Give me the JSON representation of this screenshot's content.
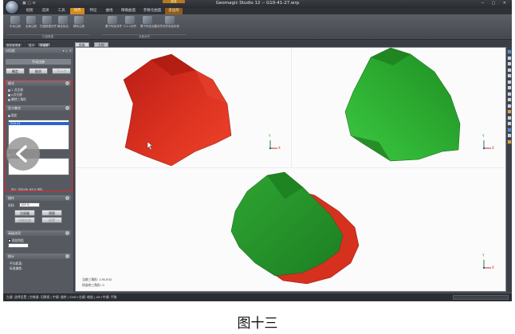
{
  "window": {
    "title": "Geomagic Studio 12 -- G10-41-27.wrp",
    "quick_access": "▣ ▢ ≡",
    "context_label": "配准",
    "controls": "─ ▢ ✕"
  },
  "ribbon": {
    "tabs": [
      {
        "label": "视图",
        "active": false
      },
      {
        "label": "选择",
        "active": false
      },
      {
        "label": "工具",
        "active": false
      },
      {
        "label": "对齐",
        "active": true
      },
      {
        "label": "特征",
        "active": false
      },
      {
        "label": "曲线",
        "active": false
      },
      {
        "label": "精确曲面",
        "active": false
      },
      {
        "label": "参数化曲面",
        "active": false
      },
      {
        "label": "多边形",
        "active": false,
        "context": true
      }
    ],
    "buttons": [
      "手动注册",
      "全局注册",
      "扫描数据对齐",
      "最佳拟合",
      "移除注册",
      "基于特征对齐",
      "3-2-1对齐",
      "基于特征创建对齐",
      "对齐到坐标系"
    ],
    "groups": [
      "扫描数据",
      "对象对齐"
    ]
  },
  "left_panel": {
    "tabs": [
      "模型管理器",
      "显示",
      "对话框"
    ],
    "header": "对话框",
    "banner": "手动注册",
    "buttons": {
      "ok": "确定",
      "cancel": "取消",
      "next": "下一个"
    },
    "mode_section": {
      "title": "模式",
      "options": [
        "1 点注册",
        "n点注册",
        "删除三角形"
      ],
      "selected": 1
    },
    "define_section": {
      "title": "定义集合",
      "fixed_label": "固定",
      "list_items": [
        "G10-41"
      ],
      "floating_label": "浮动"
    },
    "hint": "提示: 选择对象 添加点 删除",
    "ops_section": {
      "title": "操作",
      "sample_label": "采样:",
      "sample_value": "100 %",
      "register_button": "注册器",
      "view_button": "视图",
      "register_all_button": "注册全部",
      "accept_button": "接受"
    },
    "advanced_section": {
      "title": "高级选项",
      "checkbox_label": "添加到组"
    },
    "stats_section": {
      "title": "统计",
      "avg_distance": "平均距离:",
      "std_dev": "标准偏差:"
    }
  },
  "viewport": {
    "tabs": [
      "图像",
      "主视"
    ],
    "readout_triangles": "当前三角形: 176,932",
    "readout_selected": "所选的三角形: 0",
    "axis_y": "Y",
    "axis_x": "X",
    "object_colors": {
      "fixed": "#d22a1e",
      "floating": "#2fa32f"
    }
  },
  "status_bar": {
    "text": "左键: 选择设置 | 空格键: 切换视 | 中键: 旋转 | Shift+右键: 缩放 | Alt+中键: 平移"
  },
  "caption": "图十三"
}
